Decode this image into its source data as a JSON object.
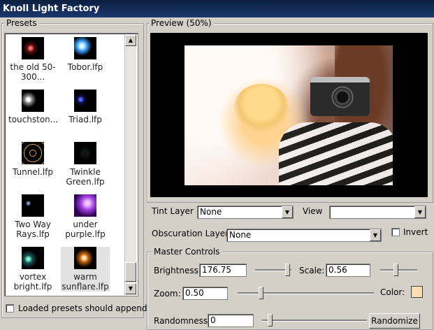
{
  "window": {
    "title": "Knoll Light Factory"
  },
  "presets": {
    "legend": "Presets",
    "items": [
      {
        "label": "the old 50-300...",
        "icon": "red-flare-icon"
      },
      {
        "label": "Tobor.lfp",
        "icon": "blue-flare-icon"
      },
      {
        "label": "touchston...",
        "icon": "white-star-icon"
      },
      {
        "label": "Triad.lfp",
        "icon": "blue-dot-icon"
      },
      {
        "label": "Tunnel.lfp",
        "icon": "gold-rings-icon"
      },
      {
        "label": "Twinkle Green.lfp",
        "icon": "dark-icon"
      },
      {
        "label": "Two Way Rays.lfp",
        "icon": "small-star-icon"
      },
      {
        "label": "under purple.lfp",
        "icon": "purple-glow-icon"
      },
      {
        "label": "vortex bright.lfp",
        "icon": "teal-flare-icon"
      },
      {
        "label": "warm sunflare.lfp",
        "icon": "warm-sun-icon"
      }
    ],
    "append_label": "Loaded presets should append"
  },
  "preview": {
    "legend": "Preview (50%)"
  },
  "tint_layer": {
    "label": "Tint Layer",
    "value": "None"
  },
  "view": {
    "label": "View",
    "value": ""
  },
  "obscuration_layer": {
    "label": "Obscuration Layer",
    "value": "None"
  },
  "invert": {
    "label": "Invert",
    "checked": false
  },
  "master": {
    "legend": "Master Controls",
    "brightness": {
      "label": "Brightness:",
      "value": "176.75"
    },
    "scale": {
      "label": "Scale:",
      "value": "0.56"
    },
    "zoom": {
      "label": "Zoom:",
      "value": "0.50"
    },
    "color": {
      "label": "Color:",
      "value": "#fcdcb0"
    },
    "randomness": {
      "label": "Randomness:",
      "value": "0"
    },
    "randomize_label": "Randomize"
  }
}
